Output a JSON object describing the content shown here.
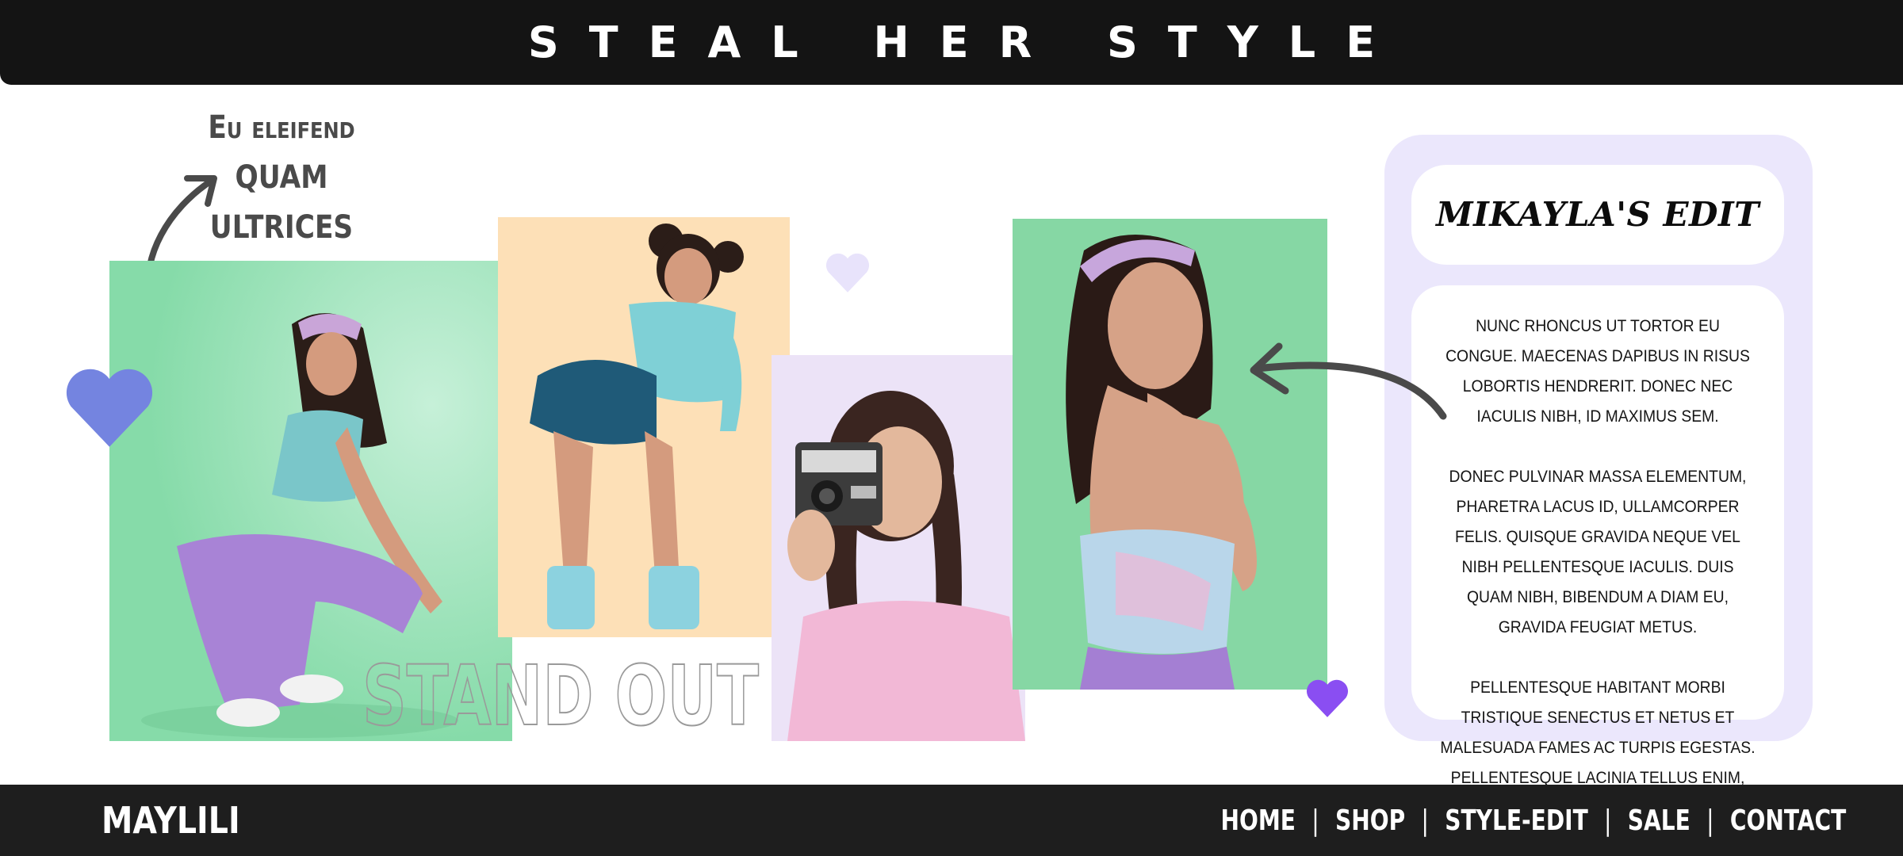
{
  "header": {
    "title": "STEAL HER STYLE"
  },
  "tagline": {
    "line1": "Eu eleifend",
    "line2": "quam",
    "line3": "ultrices ut."
  },
  "decor": {
    "stand_out": "STAND OUT"
  },
  "edit": {
    "title": "MIKAYLA'S EDIT",
    "paragraphs": [
      "Nunc rhoncus ut tortor eu congue. Maecenas dapibus in risus lobortis hendrerit. Donec nec iaculis nibh, id maximus sem.",
      "Donec pulvinar massa elementum, pharetra lacus id, ullamcorper felis. Quisque gravida neque vel nibh pellentesque iaculis. Duis quam nibh, bibendum a diam eu, gravida feugiat metus.",
      "Pellentesque habitant morbi tristique senectus et netus et malesuada fames ac turpis egestas. Pellentesque lacinia tellus enim, et varius tellus mollis sed."
    ]
  },
  "footer": {
    "brand": "MAYLILI",
    "nav": [
      "HOME",
      "SHOP",
      "STYLE-EDIT",
      "SALE",
      "CONTACT"
    ],
    "separator": "|"
  },
  "colors": {
    "bar": "#141414",
    "footer": "#1e1e1e",
    "panel": "#ebe7fc",
    "heart_blue": "#7484e0",
    "heart_purple": "#8a4ef2",
    "heart_lilac": "#e8e3fb",
    "mint": "#88dcaa",
    "peach": "#fde0b7"
  },
  "icons": [
    "heart-icon",
    "curved-arrow-icon"
  ]
}
